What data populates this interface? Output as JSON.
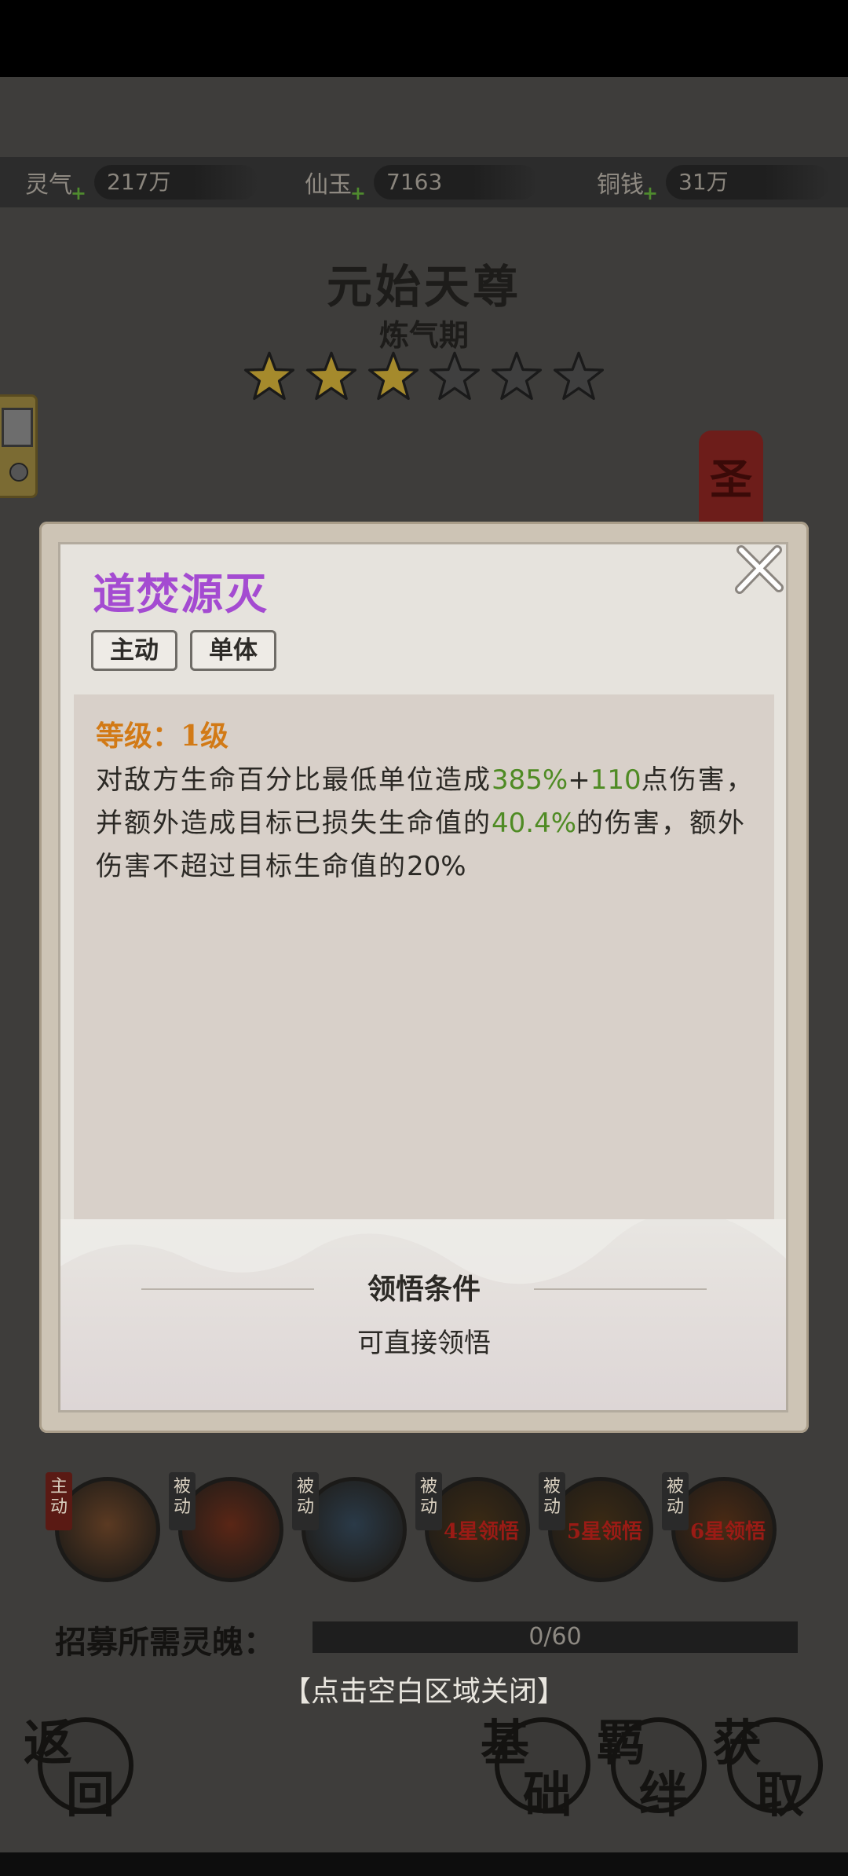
{
  "currency": [
    {
      "label": "灵气",
      "value": "217万"
    },
    {
      "label": "仙玉",
      "value": "7163"
    },
    {
      "label": "铜钱",
      "value": "31万"
    }
  ],
  "hero": {
    "name": "元始天尊",
    "realm": "炼气期",
    "stars_filled": 3,
    "stars_total": 6
  },
  "side_tag_text": "圣",
  "dialog": {
    "skill_name": "道焚源灭",
    "tags": [
      "主动",
      "单体"
    ],
    "level_label": "等级：1级",
    "desc_parts": [
      "对敌方生命百分比最低单位造成",
      "385%",
      "+",
      "110",
      "点伤害，并额外造成目标已损失生命值的",
      "40.4%",
      "的伤害，额外伤害不超过目标生命值的",
      "20%"
    ],
    "condition_title": "领悟条件",
    "condition_text": "可直接领悟"
  },
  "skills": [
    {
      "badge": "主动",
      "lock_text": ""
    },
    {
      "badge": "被动",
      "lock_text": ""
    },
    {
      "badge": "被动",
      "lock_text": ""
    },
    {
      "badge": "被动",
      "lock_text": "4星领悟"
    },
    {
      "badge": "被动",
      "lock_text": "5星领悟"
    },
    {
      "badge": "被动",
      "lock_text": "6星领悟"
    }
  ],
  "recruit": {
    "label": "招募所需灵魄：",
    "progress_text": "0/60",
    "progress_fraction": 0
  },
  "close_hint": "【点击空白区域关闭】",
  "nav": [
    {
      "c1": "返",
      "c2": "回"
    },
    {
      "c1": "基",
      "c2": "础"
    },
    {
      "c1": "羁",
      "c2": "绊"
    },
    {
      "c1": "获",
      "c2": "取"
    }
  ],
  "colors": {
    "skill_name": "#a44bd1",
    "level": "#d27a16",
    "highlight": "#4f8b24",
    "star_filled": "#a58a2c",
    "star_empty": "#3f3f3f"
  }
}
